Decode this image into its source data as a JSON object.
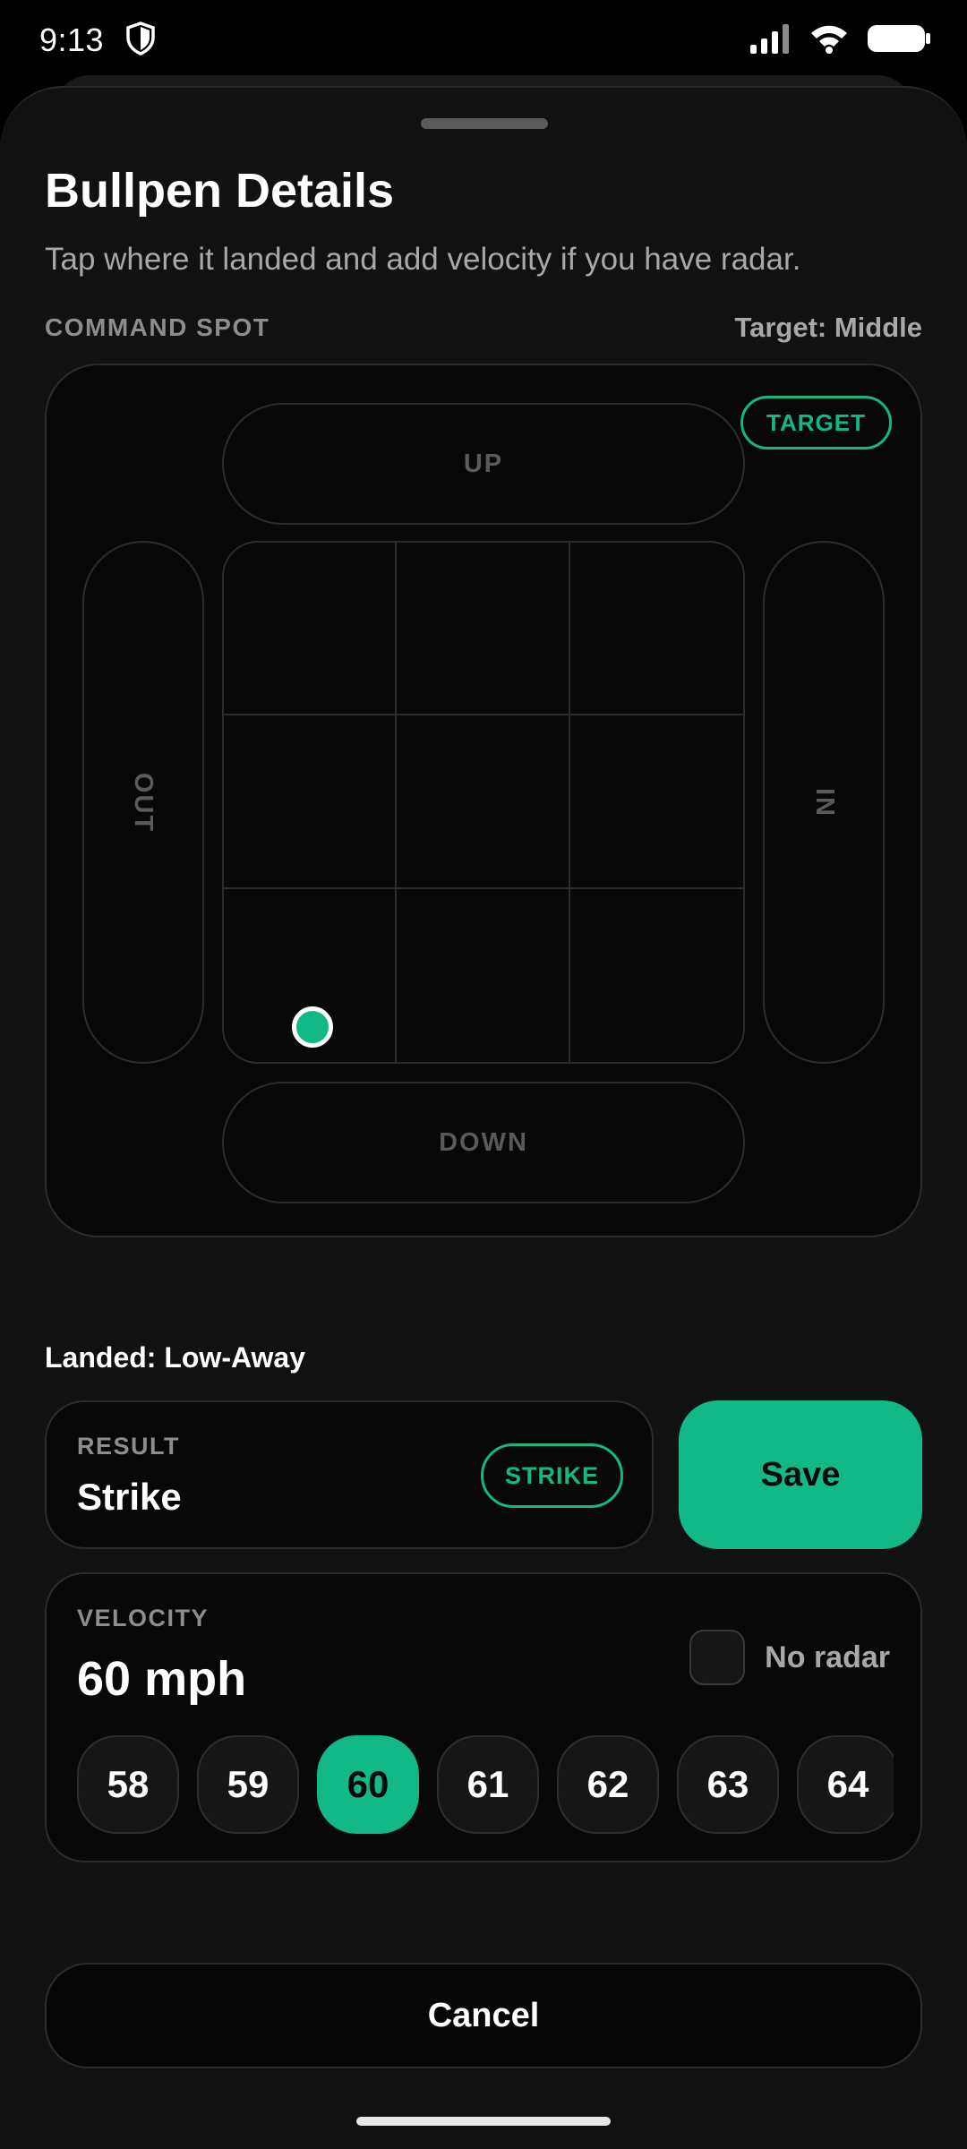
{
  "status_bar": {
    "time": "9:13"
  },
  "sheet": {
    "title": "Bullpen Details",
    "subtitle": "Tap where it landed and add velocity if you have radar."
  },
  "command_spot": {
    "label": "COMMAND SPOT",
    "target_text": "Target: Middle",
    "target_badge": "TARGET",
    "up_label": "UP",
    "down_label": "DOWN",
    "out_label": "OUT",
    "in_label": "IN",
    "landed_text": "Landed: Low-Away"
  },
  "result": {
    "label": "RESULT",
    "value": "Strike",
    "badge": "STRIKE"
  },
  "save_label": "Save",
  "velocity": {
    "label": "VELOCITY",
    "value": "60 mph",
    "no_radar_label": "No radar",
    "speeds": [
      "58",
      "59",
      "60",
      "61",
      "62",
      "63",
      "64"
    ],
    "selected_speed": "60"
  },
  "cancel_label": "Cancel",
  "colors": {
    "accent": "#12b886",
    "background": "#111111",
    "card": "#080808"
  }
}
